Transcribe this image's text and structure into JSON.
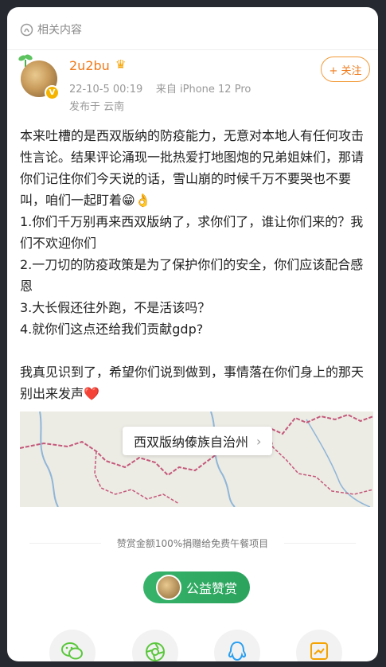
{
  "related": {
    "label": "相关内容"
  },
  "author": {
    "name": "2u2bu",
    "verified_badge": "V",
    "time": "22-10-5 00:19",
    "source": "来自 iPhone 12 Pro",
    "location": "发布于 云南"
  },
  "follow_button": {
    "label": "+ 关注"
  },
  "post": {
    "text": "本来吐槽的是西双版纳的防疫能力，无意对本地人有任何攻击性言论。结果评论涌现一批热爱打地图炮的兄弟姐妹们，那请你们记住你们今天说的话，雪山崩的时候千万不要哭也不要叫，咱们一起盯着😁👌\n1.你们千万别再来西双版纳了，求你们了，谁让你们来的？我们不欢迎你们\n2.一刀切的防疫政策是为了保护你们的安全，你们应该配合感恩\n3.大长假还往外跑，不是活该吗？\n4.就你们这点还给我们贡献gdp?\n\n我真见识到了，希望你们说到做到，事情落在你们身上的那天别出来发声❤️"
  },
  "map": {
    "place_label": "西双版纳傣族自治州",
    "chevron": "›",
    "colors": {
      "border": "#c4587a",
      "river": "#8fb6d8",
      "land": "#ecebe4"
    }
  },
  "donation": {
    "note": "赞赏金额100%捐赠给免费午餐项目",
    "button_label": "公益赞赏",
    "accent": "#2ba35d"
  },
  "share": {
    "items": [
      {
        "icon": "wechat-icon"
      },
      {
        "icon": "moments-icon"
      },
      {
        "icon": "qq-icon"
      },
      {
        "icon": "qzone-icon"
      }
    ]
  }
}
